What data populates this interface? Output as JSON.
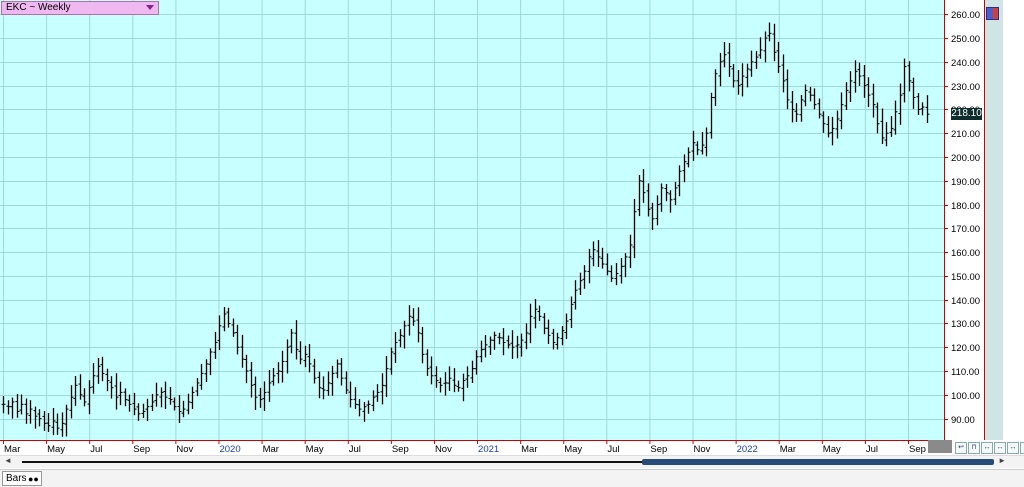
{
  "header": {
    "title": "EKC ~ Weekly"
  },
  "price_tag": "218.10",
  "nav": {
    "buttons": [
      "↩",
      "⊓",
      "↔",
      "↔",
      "↔",
      "↔"
    ]
  },
  "bottom": {
    "tab_label": "Bars",
    "toggle_icon": "toggle-icon"
  },
  "scroll": {
    "left_arrow": "◄",
    "right_arrow": "►"
  },
  "colors": {
    "background": "#c8ffff",
    "grid": "#9fd9d9",
    "bar": "#000000",
    "axis_line": "#cc0000"
  },
  "chart_data": {
    "type": "bar",
    "subtype": "ohlc",
    "title": "EKC ~ Weekly",
    "xlabel": "",
    "ylabel": "",
    "ylim": [
      81,
      266
    ],
    "y_ticks": [
      90,
      100,
      110,
      120,
      130,
      140,
      150,
      160,
      170,
      180,
      190,
      200,
      210,
      220,
      230,
      240,
      250,
      260
    ],
    "y_tick_labels": [
      "90.00",
      "100.00",
      "110.00",
      "120.00",
      "130.00",
      "140.00",
      "150.00",
      "160.00",
      "170.00",
      "180.00",
      "190.00",
      "200.00",
      "210.00",
      "220.00",
      "230.00",
      "240.00",
      "250.00",
      "260.00"
    ],
    "x_labels": [
      {
        "label": "Mar",
        "blue": false
      },
      {
        "label": "May",
        "blue": false
      },
      {
        "label": "Jul",
        "blue": false
      },
      {
        "label": "Sep",
        "blue": false
      },
      {
        "label": "Nov",
        "blue": false
      },
      {
        "label": "2020",
        "blue": true
      },
      {
        "label": "Mar",
        "blue": false
      },
      {
        "label": "May",
        "blue": false
      },
      {
        "label": "Jul",
        "blue": false
      },
      {
        "label": "Sep",
        "blue": false
      },
      {
        "label": "Nov",
        "blue": false
      },
      {
        "label": "2021",
        "blue": true
      },
      {
        "label": "Mar",
        "blue": false
      },
      {
        "label": "May",
        "blue": false
      },
      {
        "label": "Jul",
        "blue": false
      },
      {
        "label": "Sep",
        "blue": false
      },
      {
        "label": "Nov",
        "blue": false
      },
      {
        "label": "2022",
        "blue": true
      },
      {
        "label": "Mar",
        "blue": false
      },
      {
        "label": "May",
        "blue": false
      },
      {
        "label": "Jul",
        "blue": false
      },
      {
        "label": "Sep",
        "blue": false
      }
    ],
    "last_price": 218.1,
    "closes": [
      96,
      95,
      97,
      93,
      96,
      92,
      94,
      91,
      90,
      88,
      87,
      89,
      86,
      88,
      94,
      99,
      104,
      100,
      97,
      103,
      108,
      112,
      109,
      106,
      103,
      99,
      101,
      98,
      96,
      94,
      92,
      93,
      95,
      97,
      100,
      101,
      99,
      98,
      95,
      93,
      94,
      97,
      101,
      105,
      109,
      113,
      118,
      122,
      129,
      134,
      130,
      126,
      120,
      115,
      110,
      104,
      99,
      98,
      101,
      105,
      108,
      110,
      114,
      120,
      126,
      119,
      115,
      117,
      113,
      107,
      103,
      102,
      105,
      109,
      113,
      107,
      102,
      98,
      96,
      94,
      95,
      96,
      99,
      101,
      104,
      111,
      118,
      122,
      125,
      129,
      133,
      131,
      126,
      117,
      111,
      108,
      106,
      104,
      105,
      107,
      104,
      103,
      106,
      108,
      111,
      116,
      119,
      121,
      123,
      125,
      124,
      122,
      121,
      120,
      121,
      123,
      126,
      133,
      136,
      133,
      128,
      125,
      122,
      124,
      127,
      131,
      138,
      144,
      148,
      152,
      158,
      161,
      158,
      155,
      152,
      149,
      151,
      154,
      158,
      163,
      177,
      190,
      185,
      178,
      174,
      180,
      187,
      185,
      182,
      187,
      194,
      198,
      202,
      206,
      203,
      205,
      210,
      225,
      235,
      240,
      243,
      238,
      232,
      230,
      234,
      237,
      240,
      242,
      245,
      250,
      252,
      244,
      238,
      232,
      224,
      220,
      218,
      224,
      228,
      226,
      222,
      218,
      214,
      210,
      212,
      216,
      222,
      228,
      232,
      236,
      234,
      230,
      226,
      222,
      214,
      208,
      210,
      212,
      219,
      226,
      238,
      232,
      225,
      220,
      221,
      218
    ]
  }
}
